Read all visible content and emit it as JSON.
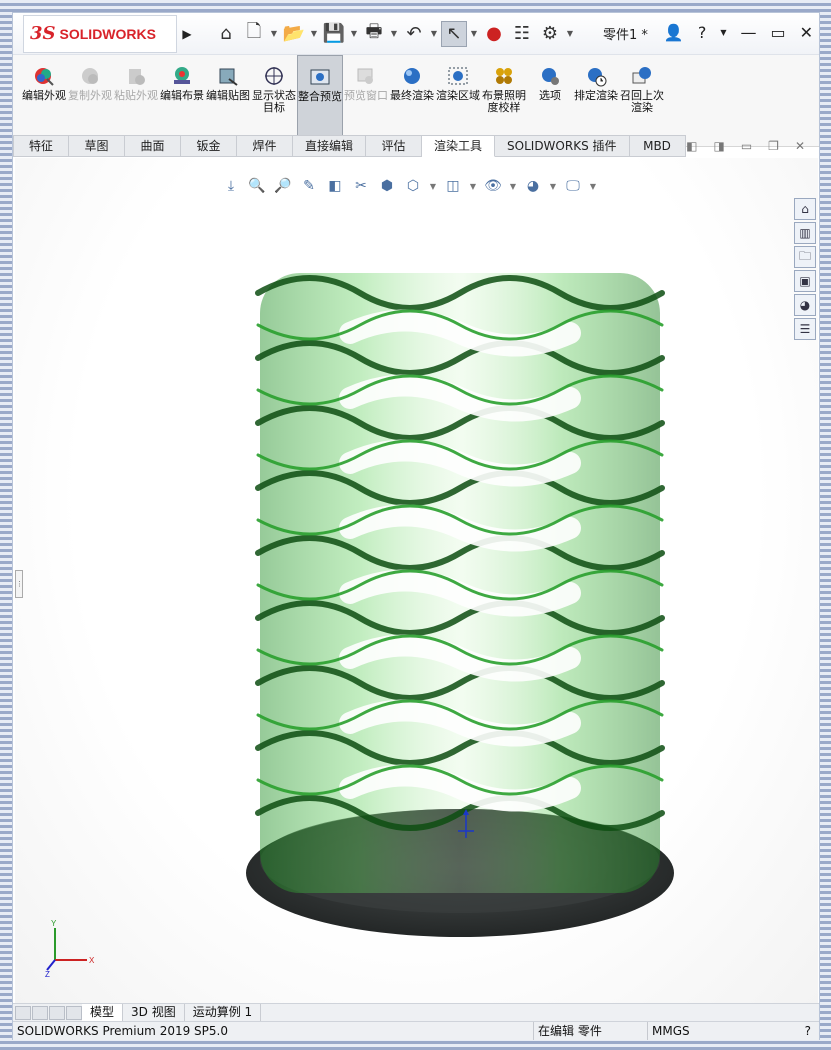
{
  "app": {
    "logo_ds": "3S",
    "logo_name": "SOLIDWORKS",
    "document_title": "零件1 *"
  },
  "titlebar": {
    "menu_arrow": "▶",
    "quick_access": [
      {
        "name": "home-icon",
        "glyph": "⌂"
      },
      {
        "name": "new-document-icon",
        "glyph": "🗋"
      },
      {
        "name": "open-icon",
        "glyph": "📂"
      },
      {
        "name": "save-icon",
        "glyph": "💾"
      },
      {
        "name": "print-icon",
        "glyph": "🖶"
      },
      {
        "name": "undo-icon",
        "glyph": "↶"
      },
      {
        "name": "select-pointer-icon",
        "glyph": "↖"
      },
      {
        "name": "rebuild-icon",
        "glyph": "●"
      },
      {
        "name": "file-properties-icon",
        "glyph": "☷"
      },
      {
        "name": "options-gear-icon",
        "glyph": "⚙"
      }
    ],
    "controls": {
      "user": "👤",
      "help": "?",
      "minimize": "—",
      "restore": "▭",
      "close": "✕"
    }
  },
  "ribbon": {
    "buttons": [
      {
        "label": "编辑外观",
        "icon": "edit-appearance-icon",
        "disabled": false,
        "active": false
      },
      {
        "label": "复制外观",
        "icon": "copy-appearance-icon",
        "disabled": true,
        "active": false
      },
      {
        "label": "粘贴外观",
        "icon": "paste-appearance-icon",
        "disabled": true,
        "active": false
      },
      {
        "label": "编辑布景",
        "icon": "edit-scene-icon",
        "disabled": false,
        "active": false
      },
      {
        "label": "编辑贴图",
        "icon": "edit-decal-icon",
        "disabled": false,
        "active": false
      },
      {
        "label": "显示状态目标",
        "icon": "display-state-target-icon",
        "disabled": false,
        "active": false
      },
      {
        "label": "整合预览",
        "icon": "integrated-preview-icon",
        "disabled": false,
        "active": true
      },
      {
        "label": "预览窗口",
        "icon": "preview-window-icon",
        "disabled": true,
        "active": false
      },
      {
        "label": "最终渲染",
        "icon": "final-render-icon",
        "disabled": false,
        "active": false
      },
      {
        "label": "渲染区域",
        "icon": "render-region-icon",
        "disabled": false,
        "active": false
      },
      {
        "label": "布景照明度校样",
        "icon": "scene-illumination-proof-icon",
        "disabled": false,
        "active": false
      },
      {
        "label": "选项",
        "icon": "options-icon",
        "disabled": false,
        "active": false
      },
      {
        "label": "排定渲染",
        "icon": "schedule-render-icon",
        "disabled": false,
        "active": false
      },
      {
        "label": "召回上次渲染",
        "icon": "recall-last-render-icon",
        "disabled": false,
        "active": false
      }
    ]
  },
  "tabs": [
    {
      "label": "特征",
      "active": false
    },
    {
      "label": "草图",
      "active": false
    },
    {
      "label": "曲面",
      "active": false
    },
    {
      "label": "钣金",
      "active": false
    },
    {
      "label": "焊件",
      "active": false
    },
    {
      "label": "直接编辑",
      "active": false
    },
    {
      "label": "评估",
      "active": false
    },
    {
      "label": "渲染工具",
      "active": true
    },
    {
      "label": "SOLIDWORKS 插件",
      "active": false
    },
    {
      "label": "MBD",
      "active": false
    }
  ],
  "bottom_tabs": [
    {
      "label": "模型",
      "active": true
    },
    {
      "label": "3D 视图",
      "active": false
    },
    {
      "label": "运动算例 1",
      "active": false
    }
  ],
  "status": {
    "product": "SOLIDWORKS Premium 2019 SP5.0",
    "mode": "在编辑 零件",
    "units": "MMGS",
    "help": "?"
  },
  "triad": {
    "x": "X",
    "y": "Y",
    "z": "Z"
  },
  "colors": {
    "accent_red": "#d8232a",
    "model_green": "#2fae2f",
    "base_dark": "#2e3232"
  }
}
